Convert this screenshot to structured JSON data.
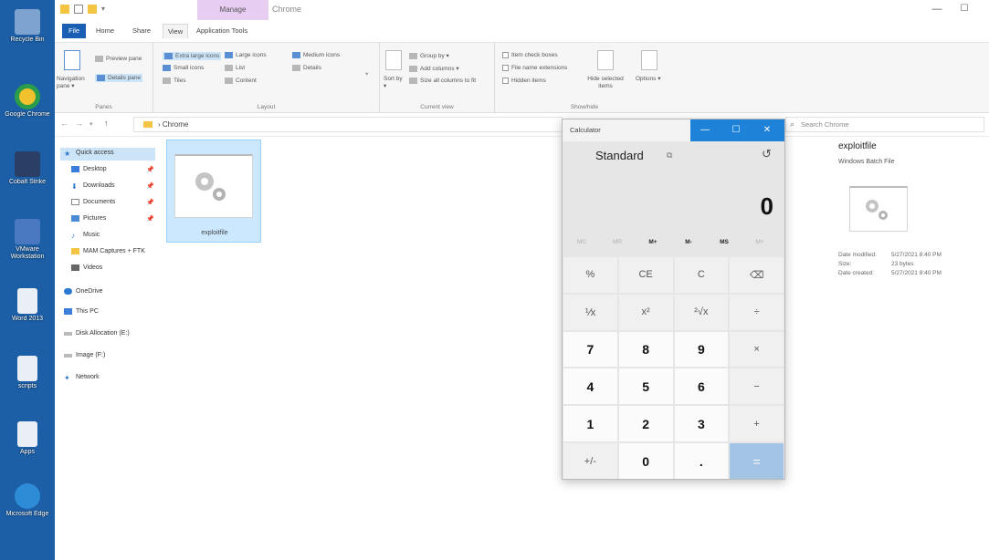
{
  "desktop": {
    "icons": [
      {
        "label": "Recycle Bin",
        "color": "#7fa3d0"
      },
      {
        "label": "Google Chrome",
        "color": "#f2c12e"
      },
      {
        "label": "Cobalt Strike",
        "color": "#2b3f66"
      },
      {
        "label": "VMware Workstation",
        "color": "#4a78c0"
      },
      {
        "label": "Word 2013",
        "color": "#eaeff5"
      },
      {
        "label": "scripts",
        "color": "#eaeff5"
      },
      {
        "label": "Apps",
        "color": "#eaeff5"
      },
      {
        "label": "Microsoft Edge",
        "color": "#2e8bd6"
      }
    ]
  },
  "explorer": {
    "manage_tab": "Manage",
    "title": "Chrome",
    "tabs": [
      "File",
      "Home",
      "Share",
      "View",
      "Application Tools"
    ],
    "ribbon": {
      "panes": {
        "title": "Panes",
        "navigation_pane": "Navigation pane ▾",
        "preview_pane": "Preview pane",
        "details_pane": "Details pane"
      },
      "layout": {
        "title": "Layout",
        "items": [
          "Extra large icons",
          "Large icons",
          "Medium icons",
          "Small icons",
          "List",
          "Details",
          "Tiles",
          "Content"
        ]
      },
      "current_view": {
        "title": "Current view",
        "sort_by": "Sort by ▾",
        "group_by": "Group by ▾",
        "add_columns": "Add columns ▾",
        "size_all": "Size all columns to fit"
      },
      "show_hide": {
        "title": "Show/hide",
        "item_check_boxes": "Item check boxes",
        "file_name_extensions": "File name extensions",
        "hidden_items": "Hidden items",
        "hide_selected": "Hide selected items",
        "options": "Options ▾"
      }
    },
    "address": {
      "path": "› Chrome"
    },
    "search": {
      "placeholder": "Search Chrome"
    },
    "nav": {
      "items": [
        {
          "label": "Quick access",
          "pinned": false
        },
        {
          "label": "Desktop",
          "pinned": true
        },
        {
          "label": "Downloads",
          "pinned": true
        },
        {
          "label": "Documents",
          "pinned": true
        },
        {
          "label": "Pictures",
          "pinned": true
        },
        {
          "label": "Music",
          "pinned": false
        },
        {
          "label": "MAM Captures + FTK",
          "pinned": false
        },
        {
          "label": "Videos",
          "pinned": false
        },
        {
          "label": "OneDrive",
          "pinned": false
        },
        {
          "label": "This PC",
          "pinned": false
        },
        {
          "label": "Disk Allocation (E:)",
          "pinned": false
        },
        {
          "label": "Image (F:)",
          "pinned": false
        },
        {
          "label": "Network",
          "pinned": false
        }
      ]
    },
    "file": {
      "name": "exploitfile"
    },
    "details": {
      "name": "exploitfile",
      "type": "Windows Batch File",
      "rows": [
        {
          "label": "Date modified:",
          "value": "5/27/2021 8:40 PM"
        },
        {
          "label": "Size:",
          "value": "23 bytes"
        },
        {
          "label": "Date created:",
          "value": "5/27/2021 8:40 PM"
        }
      ]
    }
  },
  "calculator": {
    "title": "Calculator",
    "mode": "Standard",
    "display": "0",
    "memory": [
      "MC",
      "MR",
      "M+",
      "M-",
      "MS",
      "M˅"
    ],
    "memory_enabled": [
      false,
      false,
      true,
      true,
      true,
      false
    ],
    "keys": [
      {
        "label": "%",
        "kind": "op"
      },
      {
        "label": "CE",
        "kind": "op"
      },
      {
        "label": "C",
        "kind": "op"
      },
      {
        "label": "⌫",
        "kind": "op"
      },
      {
        "label": "⅟x",
        "kind": "op"
      },
      {
        "label": "x²",
        "kind": "op"
      },
      {
        "label": "²√x",
        "kind": "op"
      },
      {
        "label": "÷",
        "kind": "op"
      },
      {
        "label": "7",
        "kind": "num"
      },
      {
        "label": "8",
        "kind": "num"
      },
      {
        "label": "9",
        "kind": "num"
      },
      {
        "label": "×",
        "kind": "op"
      },
      {
        "label": "4",
        "kind": "num"
      },
      {
        "label": "5",
        "kind": "num"
      },
      {
        "label": "6",
        "kind": "num"
      },
      {
        "label": "−",
        "kind": "op"
      },
      {
        "label": "1",
        "kind": "num"
      },
      {
        "label": "2",
        "kind": "num"
      },
      {
        "label": "3",
        "kind": "num"
      },
      {
        "label": "+",
        "kind": "op"
      },
      {
        "label": "+/-",
        "kind": "op"
      },
      {
        "label": "0",
        "kind": "num"
      },
      {
        "label": ".",
        "kind": "num"
      },
      {
        "label": "=",
        "kind": "eq"
      }
    ],
    "accent": "#1e82d8"
  }
}
